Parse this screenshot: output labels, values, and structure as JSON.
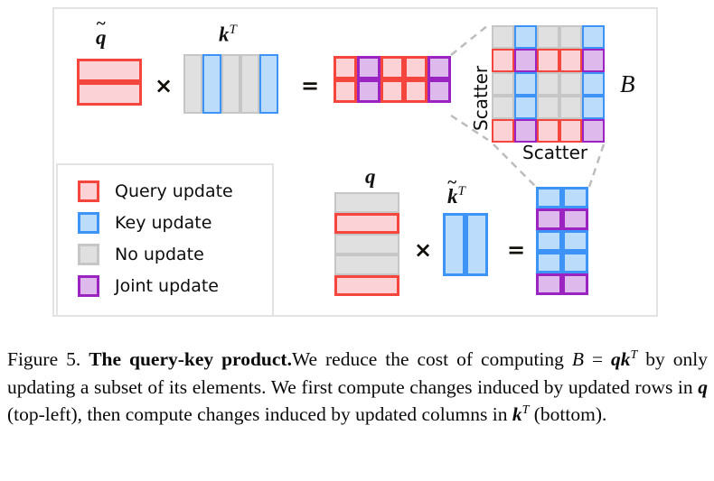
{
  "figure": {
    "id": "Figure 5.",
    "title": "The query-key product.",
    "caption_part1": "We reduce the cost of computing ",
    "caption_math_B": "B",
    "caption_eq": " = ",
    "caption_math_q": "q",
    "caption_math_k": "k",
    "caption_math_T": "T",
    "caption_part2": " by only updating a subset of its elements. We first compute changes induced by updated rows in ",
    "caption_math_q2": "q",
    "caption_part3": " (top-left), then compute changes induced by updated columns in ",
    "caption_math_k2": "k",
    "caption_math_T2": "T",
    "caption_part4": " (bottom)."
  },
  "legend": {
    "items": [
      {
        "label": "Query update",
        "swatch": "query",
        "fill": "#fbd2d6",
        "stroke": "#f4463c"
      },
      {
        "label": "Key update",
        "swatch": "key",
        "fill": "#bcdcfb",
        "stroke": "#3d94f6"
      },
      {
        "label": "No update",
        "swatch": "none",
        "fill": "#e0e0e0",
        "stroke": "#c6c6c6"
      },
      {
        "label": "Joint update",
        "swatch": "joint",
        "fill": "#ddb9ec",
        "stroke": "#9b23c2"
      }
    ]
  },
  "labels": {
    "q_tilde": "q",
    "k_transpose": "k",
    "transpose_sup": "T",
    "q_plain": "q",
    "k_tilde": "k",
    "B": "B",
    "scatter_vertical": "Scatter",
    "scatter_horizontal": "Scatter",
    "times": "×",
    "equals": "="
  },
  "chart_data": {
    "type": "diagram",
    "description": "Query-key product B = q k^T with sparse row/column updates",
    "top_equation": {
      "operand_a": {
        "name": "q_tilde",
        "rows": 2,
        "cols": 1,
        "cells": [
          [
            "query"
          ],
          [
            "query"
          ]
        ]
      },
      "operator1": "×",
      "operand_b": {
        "name": "k_transpose",
        "rows": 1,
        "cols": 5,
        "cells": [
          [
            "none",
            "key",
            "none",
            "none",
            "key"
          ]
        ]
      },
      "operator2": "=",
      "result": {
        "name": "top_result",
        "rows": 2,
        "cols": 5,
        "cells": [
          [
            "query",
            "joint",
            "query",
            "query",
            "joint"
          ],
          [
            "query",
            "joint",
            "query",
            "query",
            "joint"
          ]
        ]
      }
    },
    "bottom_equation": {
      "operand_a": {
        "name": "q_plain",
        "rows": 5,
        "cols": 1,
        "cells": [
          [
            "none"
          ],
          [
            "query"
          ],
          [
            "none"
          ],
          [
            "none"
          ],
          [
            "query"
          ]
        ]
      },
      "operator1": "×",
      "operand_b": {
        "name": "k_tilde_transpose",
        "rows": 1,
        "cols": 2,
        "cells": [
          [
            "key",
            "key"
          ]
        ]
      },
      "operator2": "=",
      "result": {
        "name": "bottom_result",
        "rows": 5,
        "cols": 2,
        "cells": [
          [
            "key",
            "key"
          ],
          [
            "joint",
            "joint"
          ],
          [
            "key",
            "key"
          ],
          [
            "key",
            "key"
          ],
          [
            "joint",
            "joint"
          ]
        ]
      }
    },
    "B_matrix": {
      "name": "B",
      "rows": 5,
      "cols": 5,
      "updated_rows": [
        2,
        5
      ],
      "updated_cols": [
        2,
        5
      ],
      "cells": [
        [
          "none",
          "key",
          "none",
          "none",
          "key"
        ],
        [
          "query",
          "joint",
          "query",
          "query",
          "joint"
        ],
        [
          "none",
          "key",
          "none",
          "none",
          "key"
        ],
        [
          "none",
          "key",
          "none",
          "none",
          "key"
        ],
        [
          "query",
          "joint",
          "query",
          "query",
          "joint"
        ]
      ]
    }
  }
}
